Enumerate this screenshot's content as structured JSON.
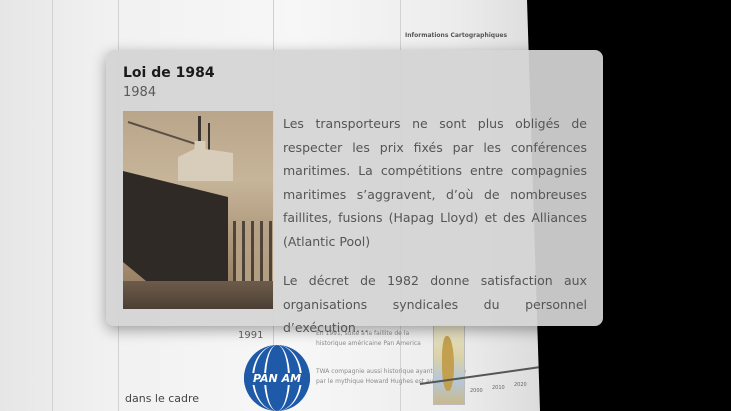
{
  "background": {
    "year_label": "1991",
    "partial_caption": "dans le cadre",
    "panam_text": "PAN AM",
    "side_heading": "Informations Cartographiques",
    "snippet_lines": [
      "En 1991, suite à la faillite de la",
      "historique américaine Pan America",
      "TWA compagnie aussi historique ayant développé",
      "par le mythique Howard Hughes est aussi"
    ],
    "axis_ticks": [
      "2000",
      "2010",
      "2020"
    ]
  },
  "card": {
    "title": "Loi de 1984",
    "year": "1984",
    "paragraph1": "Les transporteurs ne sont plus obligés de respecter les prix fixés par les conférences maritimes. La compétitions entre compagnies maritimes s’aggravent, d’où de nombreuses faillites, fusions (Hapag Lloyd) et des Alliances (Atlantic Pool)",
    "paragraph2": "Le décret de 1982 donne satisfaction aux organisations syndicales du personnel d’exécution…",
    "image_subject": "ship-in-drydock"
  }
}
